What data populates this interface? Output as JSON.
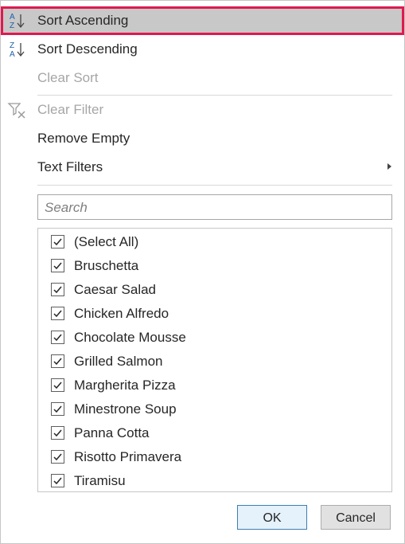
{
  "menu": {
    "sort_asc": "Sort Ascending",
    "sort_desc": "Sort Descending",
    "clear_sort": "Clear Sort",
    "clear_filter": "Clear Filter",
    "remove_empty": "Remove Empty",
    "text_filters": "Text Filters"
  },
  "icons": {
    "sort_asc": "sort-ascending-icon",
    "sort_desc": "sort-descending-icon",
    "clear_filter": "clear-filter-icon",
    "submenu": "chevron-right-icon"
  },
  "sort_icon_letters": {
    "a": "A",
    "z": "Z"
  },
  "search": {
    "placeholder": "Search"
  },
  "items": [
    {
      "label": "(Select All)",
      "checked": true
    },
    {
      "label": "Bruschetta",
      "checked": true
    },
    {
      "label": "Caesar Salad",
      "checked": true
    },
    {
      "label": "Chicken Alfredo",
      "checked": true
    },
    {
      "label": "Chocolate Mousse",
      "checked": true
    },
    {
      "label": "Grilled Salmon",
      "checked": true
    },
    {
      "label": "Margherita Pizza",
      "checked": true
    },
    {
      "label": "Minestrone Soup",
      "checked": true
    },
    {
      "label": "Panna Cotta",
      "checked": true
    },
    {
      "label": "Risotto Primavera",
      "checked": true
    },
    {
      "label": "Tiramisu",
      "checked": true
    }
  ],
  "buttons": {
    "ok": "OK",
    "cancel": "Cancel"
  },
  "colors": {
    "highlight": "#c8c8c8",
    "focus_outline": "#e0194f",
    "ok_border": "#3c7fb1",
    "icon_blue": "#1e5fa8"
  }
}
